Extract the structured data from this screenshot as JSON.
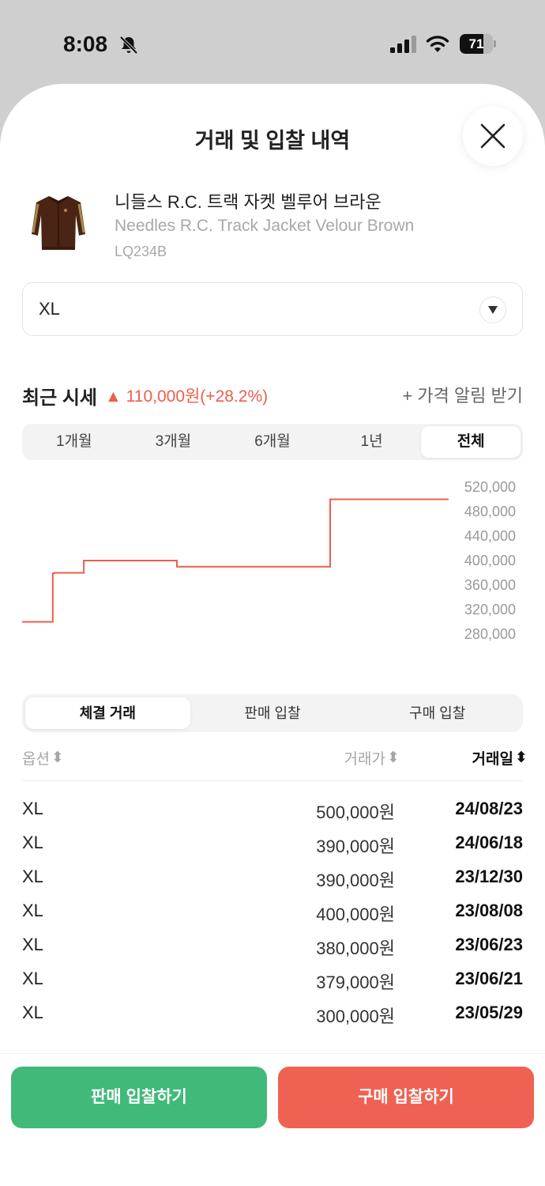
{
  "status_bar": {
    "time": "8:08",
    "battery": "71",
    "battery_level": 0.71
  },
  "sheet": {
    "title": "거래 및 입찰 내역"
  },
  "product": {
    "name_ko": "니들스 R.C. 트랙 자켓 벨루어 브라운",
    "name_en": "Needles R.C. Track Jacket Velour Brown",
    "code": "LQ234B"
  },
  "size_select": {
    "value": "XL"
  },
  "recent": {
    "label": "최근 시세",
    "arrow": "▲",
    "change": "110,000원(+28.2%)"
  },
  "alert": {
    "label": "+ 가격 알림 받기"
  },
  "period_tabs": [
    {
      "label": "1개월",
      "active": false
    },
    {
      "label": "3개월",
      "active": false
    },
    {
      "label": "6개월",
      "active": false
    },
    {
      "label": "1년",
      "active": false
    },
    {
      "label": "전체",
      "active": true
    }
  ],
  "chart_data": {
    "type": "line",
    "step": true,
    "color": "#ee5e4a",
    "x": [
      "23/05/29",
      "23/06/21",
      "23/06/23",
      "23/08/08",
      "23/12/30",
      "24/06/18",
      "24/08/23",
      "now"
    ],
    "values": [
      300000,
      379000,
      380000,
      400000,
      390000,
      390000,
      500000,
      500000
    ],
    "y_ticks": [
      "520,000",
      "480,000",
      "440,000",
      "400,000",
      "360,000",
      "320,000",
      "280,000"
    ],
    "ylim": [
      280000,
      520000
    ],
    "y_axis": "right",
    "grid": false
  },
  "trade_tabs": [
    {
      "label": "체결 거래",
      "active": true
    },
    {
      "label": "판매 입찰",
      "active": false
    },
    {
      "label": "구매 입찰",
      "active": false
    }
  ],
  "table": {
    "headers": {
      "option": "옵션",
      "price": "거래가",
      "date": "거래일"
    },
    "sort_icon": "⬍",
    "rows": [
      {
        "option": "XL",
        "price": "500,000원",
        "date": "24/08/23"
      },
      {
        "option": "XL",
        "price": "390,000원",
        "date": "24/06/18"
      },
      {
        "option": "XL",
        "price": "390,000원",
        "date": "23/12/30"
      },
      {
        "option": "XL",
        "price": "400,000원",
        "date": "23/08/08"
      },
      {
        "option": "XL",
        "price": "380,000원",
        "date": "23/06/23"
      },
      {
        "option": "XL",
        "price": "379,000원",
        "date": "23/06/21"
      },
      {
        "option": "XL",
        "price": "300,000원",
        "date": "23/05/29"
      }
    ]
  },
  "buttons": {
    "sell": "판매 입찰하기",
    "buy": "구매 입찰하기"
  },
  "colors": {
    "sell": "#41b979",
    "buy": "#ef6253",
    "accent": "#ee5e4a"
  }
}
